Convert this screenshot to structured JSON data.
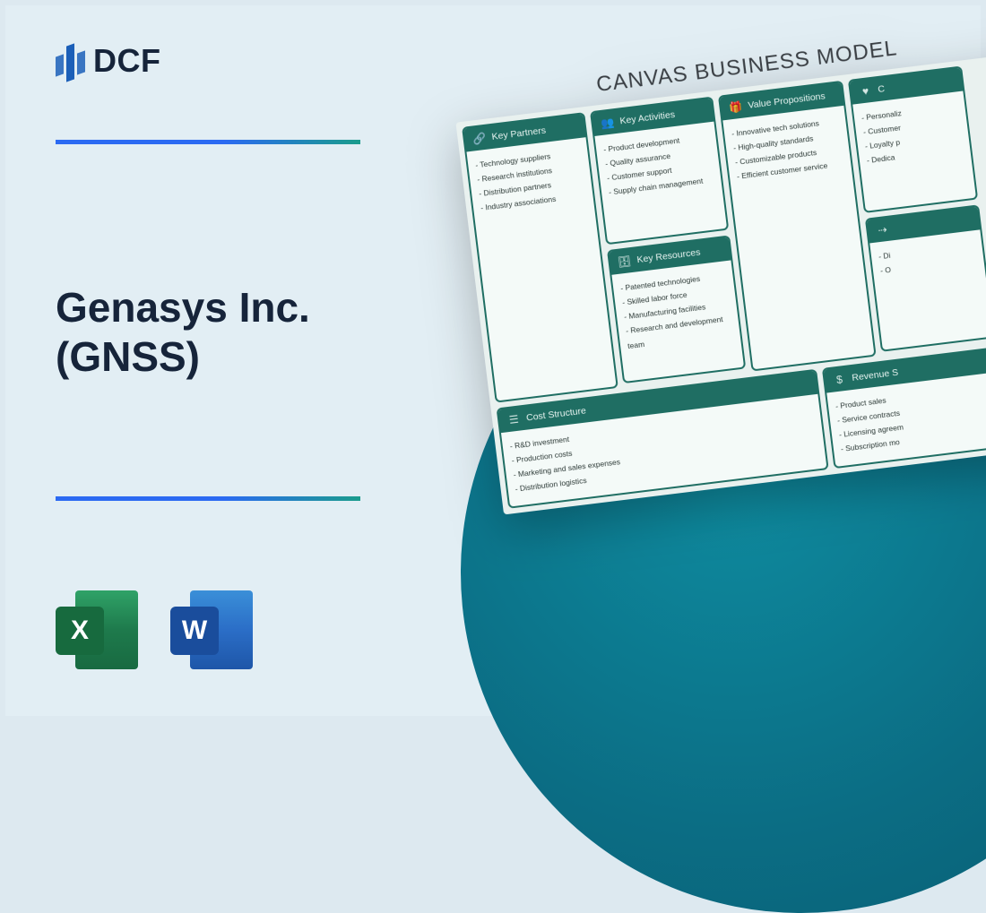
{
  "logo": {
    "text": "DCF"
  },
  "title_line1": "Genasys Inc.",
  "title_line2": "(GNSS)",
  "icons": {
    "excel": "X",
    "word": "W"
  },
  "canvas": {
    "title": "CANVAS BUSINESS MODEL",
    "key_partners": {
      "label": "Key Partners",
      "items": [
        "Technology suppliers",
        "Research institutions",
        "Distribution partners",
        "Industry associations"
      ]
    },
    "key_activities": {
      "label": "Key Activities",
      "items": [
        "Product development",
        "Quality assurance",
        "Customer support",
        "Supply chain management"
      ]
    },
    "key_resources": {
      "label": "Key Resources",
      "items": [
        "Patented technologies",
        "Skilled labor force",
        "Manufacturing facilities",
        "Research and development team"
      ]
    },
    "value_propositions": {
      "label": "Value Propositions",
      "items": [
        "Innovative tech solutions",
        "High-quality standards",
        "Customizable products",
        "Efficient customer service"
      ]
    },
    "customer_relationships": {
      "label": "C",
      "items": [
        "Personaliz",
        "Customer",
        "Loyalty p",
        "Dedica"
      ]
    },
    "cost_structure": {
      "label": "Cost Structure",
      "items": [
        "R&D investment",
        "Production costs",
        "Marketing and sales expenses",
        "Distribution logistics"
      ]
    },
    "revenue_streams": {
      "label": "Revenue S",
      "items": [
        "Product sales",
        "Service contracts",
        "Licensing agreem",
        "Subscription mo"
      ]
    },
    "partial_box": {
      "items": [
        "Di",
        "O"
      ]
    }
  }
}
